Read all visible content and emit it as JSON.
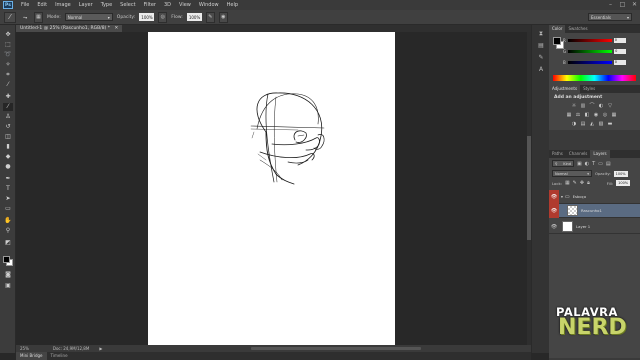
{
  "app": {
    "logo": "Ps"
  },
  "menubar": {
    "items": [
      "File",
      "Edit",
      "Image",
      "Layer",
      "Type",
      "Select",
      "Filter",
      "3D",
      "View",
      "Window",
      "Help"
    ]
  },
  "window_controls": [
    "minimize-icon",
    "maximize-icon",
    "close-icon"
  ],
  "options_bar": {
    "mode_label": "Mode:",
    "mode_value": "Normal",
    "opacity_label": "Opacity:",
    "opacity_value": "100%",
    "flow_label": "Flow:",
    "flow_value": "100%",
    "workspace_value": "Essentials"
  },
  "document": {
    "tab_title": "Untitled-1 @ 25% (Rascunho1, RGB/8) *"
  },
  "status": {
    "zoom": "25%",
    "doc_info": "Doc: 24,9M/12,8M"
  },
  "bottom_tabs": [
    "Mini Bridge",
    "Timeline"
  ],
  "color_panel": {
    "tabs": [
      "Color",
      "Swatches"
    ],
    "channels": [
      {
        "label": "R",
        "value": "0",
        "color": "#e04040"
      },
      {
        "label": "G",
        "value": "0",
        "color": "#40c040"
      },
      {
        "label": "B",
        "value": "0",
        "color": "#4060e0"
      }
    ]
  },
  "adjustments_panel": {
    "tabs": [
      "Adjustments",
      "Styles"
    ],
    "title": "Add an adjustment"
  },
  "layers_panel": {
    "tabs": [
      "Paths",
      "Channels",
      "Layers"
    ],
    "filter_label": "Kind",
    "blend_mode": "Normal",
    "opacity_label": "Opacity:",
    "opacity_value": "100%",
    "lock_label": "Lock:",
    "fill_label": "Fill:",
    "fill_value": "100%",
    "layers": [
      {
        "name": "Esboço",
        "type": "group",
        "selected": false
      },
      {
        "name": "Rascunho1",
        "type": "layer",
        "selected": true
      },
      {
        "name": "Layer 1",
        "type": "layer",
        "selected": false
      }
    ]
  },
  "watermark": {
    "line1": "PALAVRA",
    "line2": "NERD"
  }
}
